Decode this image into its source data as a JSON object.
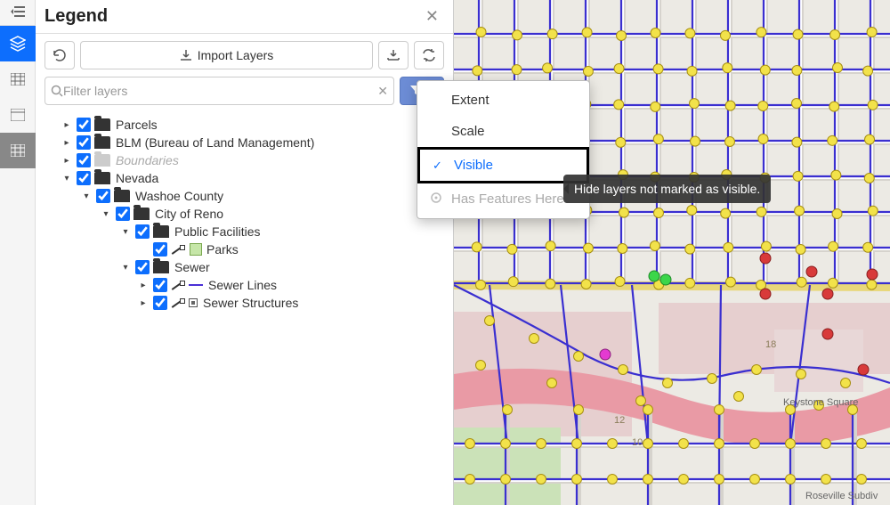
{
  "panel": {
    "title": "Legend",
    "import_label": "Import Layers",
    "search_placeholder": "Filter layers"
  },
  "filter_menu": {
    "items": [
      {
        "label": "Extent",
        "checked": false,
        "disabled": false
      },
      {
        "label": "Scale",
        "checked": false,
        "disabled": false
      },
      {
        "label": "Visible",
        "checked": true,
        "disabled": false
      },
      {
        "label": "Has Features Here",
        "checked": false,
        "disabled": true
      }
    ]
  },
  "tooltip": {
    "text": "Hide layers not marked as visible."
  },
  "tree": {
    "nodes": [
      {
        "label": "Parcels",
        "checked": true,
        "expanded": false,
        "indent": 1,
        "kind": "folder"
      },
      {
        "label": "BLM (Bureau of Land Management)",
        "checked": true,
        "expanded": false,
        "indent": 1,
        "kind": "folder"
      },
      {
        "label": "Boundaries",
        "checked": true,
        "expanded": false,
        "indent": 1,
        "kind": "folder",
        "dim": true
      },
      {
        "label": "Nevada",
        "checked": true,
        "expanded": true,
        "indent": 1,
        "kind": "folder"
      },
      {
        "label": "Washoe County",
        "checked": true,
        "expanded": true,
        "indent": 2,
        "kind": "folder"
      },
      {
        "label": "City of Reno",
        "checked": true,
        "expanded": true,
        "indent": 3,
        "kind": "folder"
      },
      {
        "label": "Public Facilities",
        "checked": true,
        "expanded": true,
        "indent": 4,
        "kind": "folder"
      },
      {
        "label": "Parks",
        "checked": true,
        "expanded": false,
        "indent": 5,
        "kind": "layer",
        "sym": "parks"
      },
      {
        "label": "Sewer",
        "checked": true,
        "expanded": true,
        "indent": 4,
        "kind": "folder"
      },
      {
        "label": "Sewer Lines",
        "checked": true,
        "expanded": false,
        "indent": 5,
        "kind": "layer",
        "sym": "line"
      },
      {
        "label": "Sewer Structures",
        "checked": true,
        "expanded": false,
        "indent": 5,
        "kind": "layer",
        "sym": "point"
      }
    ]
  },
  "map": {
    "labels": {
      "keystone_square": "Keystone Square",
      "roseville": "Roseville Subdiv",
      "label_10": "10",
      "label_12": "12",
      "label_18": "18"
    }
  }
}
